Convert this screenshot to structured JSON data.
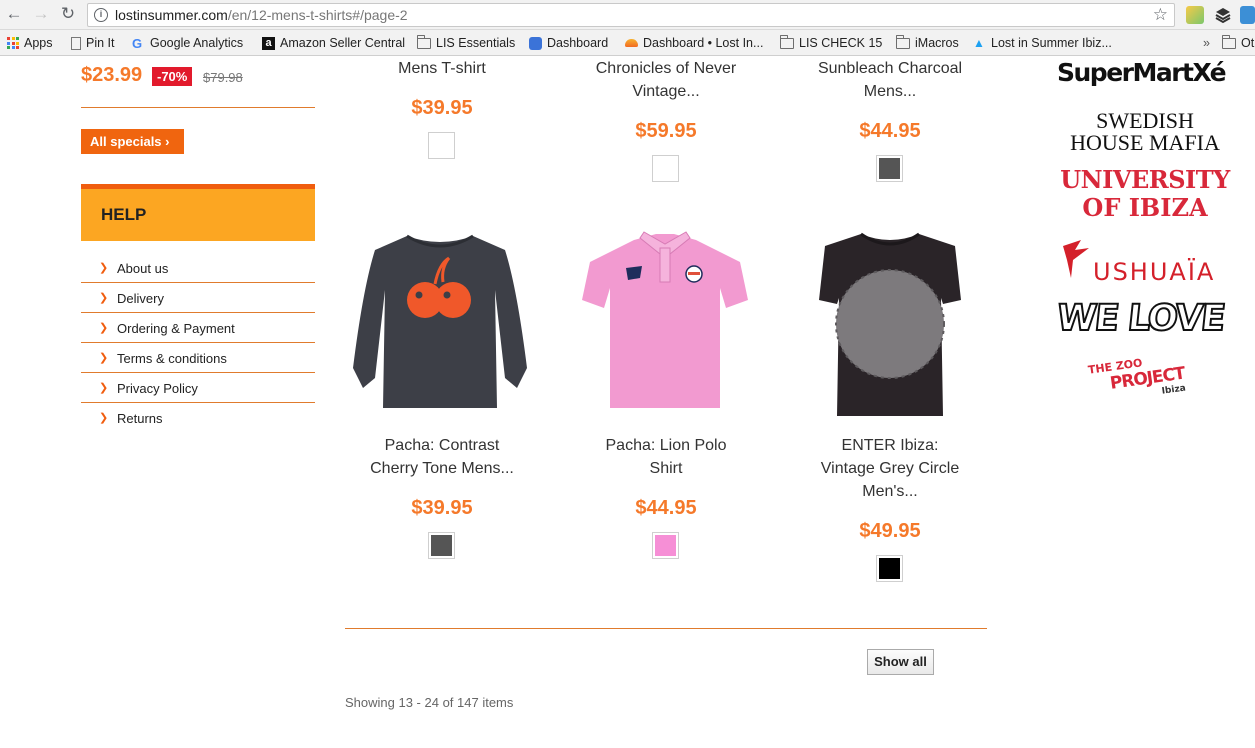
{
  "browser": {
    "url_host": "lostinsummer.com",
    "url_path": "/en/12-mens-t-shirts#/page-2",
    "bookmarks": [
      {
        "label": "Apps"
      },
      {
        "label": "Pin It"
      },
      {
        "label": "Google Analytics"
      },
      {
        "label": "Amazon Seller Central"
      },
      {
        "label": "LIS Essentials"
      },
      {
        "label": "Dashboard"
      },
      {
        "label": "Dashboard • Lost In..."
      },
      {
        "label": "LIS CHECK 15"
      },
      {
        "label": "iMacros"
      },
      {
        "label": "Lost in Summer Ibiz..."
      },
      {
        "label": "Ot"
      }
    ],
    "overflow_label": "»"
  },
  "sidebar": {
    "special_price": "$23.99",
    "special_discount": "-70%",
    "special_old_price": "$79.98",
    "all_specials_label": "All specials",
    "help_title": "HELP",
    "help_items": [
      {
        "label": "About us"
      },
      {
        "label": "Delivery"
      },
      {
        "label": "Ordering & Payment"
      },
      {
        "label": "Terms & conditions"
      },
      {
        "label": "Privacy Policy"
      },
      {
        "label": "Returns"
      }
    ]
  },
  "products_top": [
    {
      "name_lines": [
        "Mens T-shirt"
      ],
      "price": "$39.95",
      "swatch": "#ffffff"
    },
    {
      "name_lines": [
        "Chronicles of Never",
        "Vintage..."
      ],
      "price": "$59.95",
      "swatch": "#ffffff"
    },
    {
      "name_lines": [
        "Sunbleach Charcoal",
        "Mens..."
      ],
      "price": "$44.95",
      "swatch": "#555555"
    }
  ],
  "products": [
    {
      "name_lines": [
        "Pacha: Contrast",
        "Cherry Tone Mens..."
      ],
      "price": "$39.95",
      "swatch": "#555555",
      "shirt_color": "#3d3f47"
    },
    {
      "name_lines": [
        "Pacha: Lion Polo",
        "Shirt"
      ],
      "price": "$44.95",
      "swatch": "#f68fd6",
      "shirt_color": "#f29ad0"
    },
    {
      "name_lines": [
        "ENTER Ibiza:",
        "Vintage Grey Circle",
        "Men's..."
      ],
      "price": "$49.95",
      "swatch": "#000000",
      "shirt_color": "#2a2428"
    }
  ],
  "pager": {
    "show_all_label": "Show all",
    "showing_text": "Showing 13 - 24 of 147 items"
  },
  "brands": [
    {
      "name": "SuperMartXé"
    },
    {
      "name_lines": [
        "SWEDISH",
        "HOUSE MAFIA"
      ]
    },
    {
      "name_lines": [
        "UNIVERSITY",
        "OF IBIZA"
      ]
    },
    {
      "name": "USHUAÏA"
    },
    {
      "name": "WE LOVE"
    },
    {
      "name_lines": [
        "THE ZOO",
        "PROJECT"
      ],
      "sub": "Ibiza"
    }
  ],
  "colors": {
    "accent": "#f5792a",
    "help_bg": "#fca622",
    "sale_red": "#e21a2c"
  }
}
